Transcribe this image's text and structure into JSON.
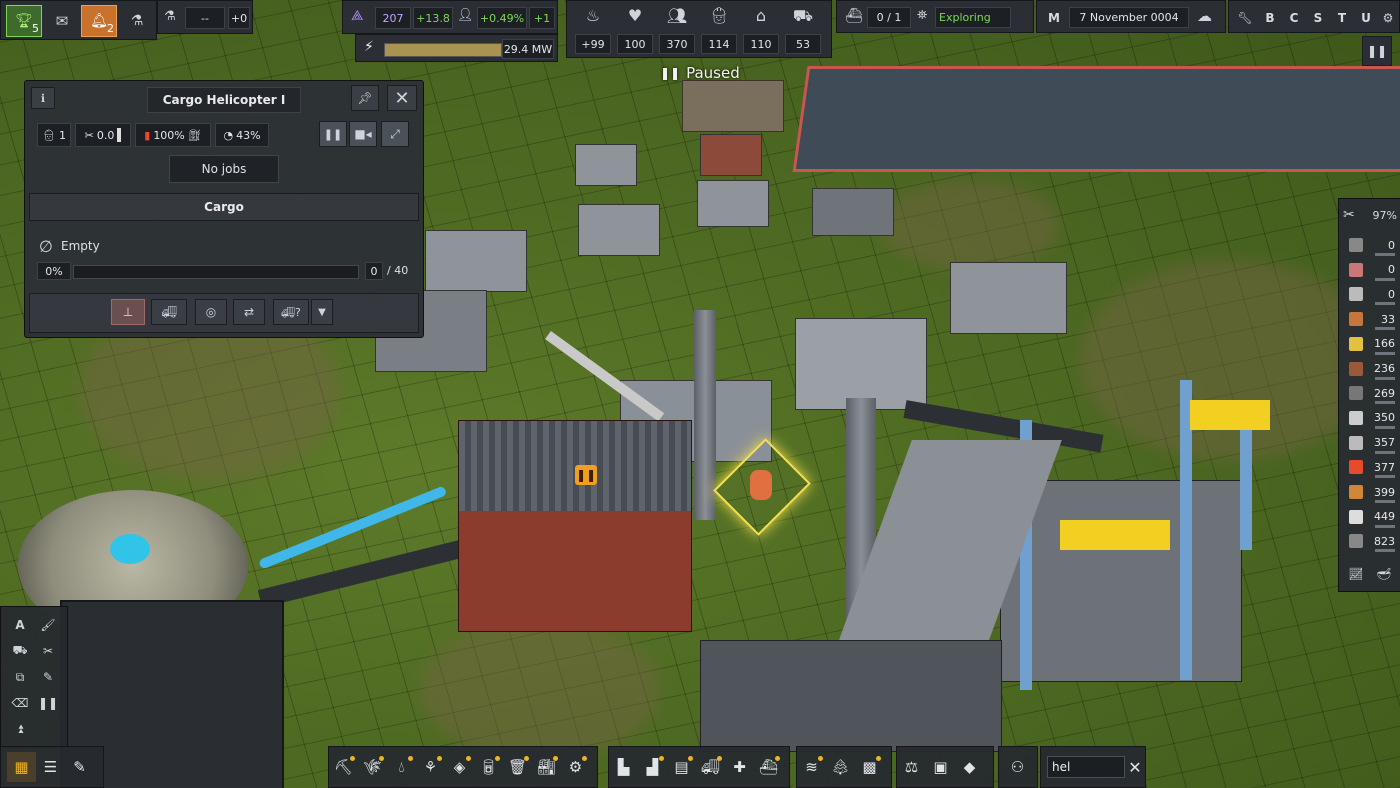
{
  "topbar": {
    "achievements_count": "5",
    "notifications_count": "2",
    "research_value": "--",
    "research_delta": "+0",
    "unity_value": "207",
    "unity_delta": "+13.8",
    "population_growth": "+0.49%",
    "population_delta": "+1",
    "power_value": "29.4 MW",
    "stats": [
      {
        "icon": "food-icon",
        "value": "+99"
      },
      {
        "icon": "health-icon",
        "value": "100"
      },
      {
        "icon": "population-icon",
        "value": "370"
      },
      {
        "icon": "workers-icon",
        "value": "114"
      },
      {
        "icon": "housing-icon",
        "value": "110"
      },
      {
        "icon": "vehicles-icon",
        "value": "53"
      }
    ],
    "ships_value": "0 / 1",
    "exploring_label": "Exploring",
    "date_m": "M",
    "date": "7 November 0004",
    "menu_letters": [
      "B",
      "C",
      "S",
      "T",
      "U"
    ]
  },
  "paused_label": "Paused",
  "window": {
    "title": "Cargo Helicopter I",
    "workers": "1",
    "maintenance": "0.0",
    "fuel": "100%",
    "efficiency": "43%",
    "jobs_label": "No jobs",
    "cargo_header": "Cargo",
    "cargo_status": "Empty",
    "cargo_percent": "0%",
    "cargo_amount": "0",
    "cargo_capacity": "/ 40",
    "cargo_fill": 0
  },
  "resources": {
    "maintenance_percent": "97%",
    "items": [
      {
        "icon": "iron-ore-icon",
        "value": "0"
      },
      {
        "icon": "food-crate-icon",
        "value": "0"
      },
      {
        "icon": "slag-icon",
        "value": "0"
      },
      {
        "icon": "wood-icon",
        "value": "33"
      },
      {
        "icon": "construction-parts-icon",
        "value": "166"
      },
      {
        "icon": "coal-icon",
        "value": "236"
      },
      {
        "icon": "bricks-icon",
        "value": "269"
      },
      {
        "icon": "tools-icon",
        "value": "350"
      },
      {
        "icon": "concrete-icon",
        "value": "357"
      },
      {
        "icon": "diesel-icon",
        "value": "377"
      },
      {
        "icon": "planks-icon",
        "value": "399"
      },
      {
        "icon": "steel-icon",
        "value": "449"
      },
      {
        "icon": "iron-icon",
        "value": "823"
      }
    ]
  },
  "search": {
    "value": "hel"
  },
  "colors": {
    "accent_green": "#7ed957",
    "accent_orange": "#f0a020",
    "unity_purple": "#b892ff"
  }
}
